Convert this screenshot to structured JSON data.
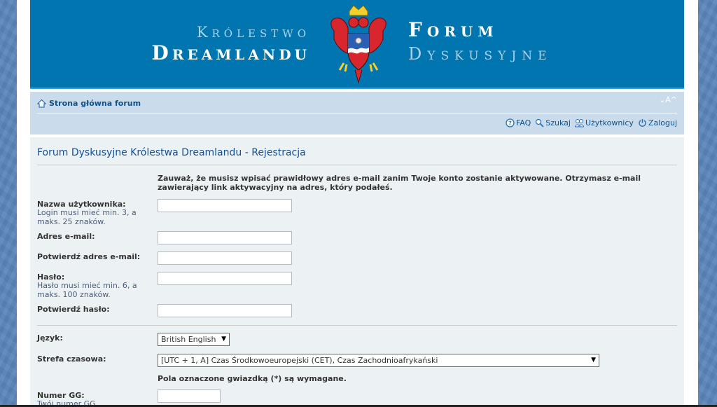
{
  "header": {
    "left_line1": "Królestwo",
    "left_line2": "Dreamlandu",
    "right_line1": "Forum",
    "right_line2": "Dyskusyjne",
    "crest_icon": "coat-of-arms-eagle-icon"
  },
  "navbar": {
    "breadcrumb_home": "Strona główna forum",
    "font_size_control": "⌄A^",
    "links": [
      {
        "label": "FAQ",
        "icon": "faq-icon"
      },
      {
        "label": "Szukaj",
        "icon": "search-icon"
      },
      {
        "label": "Użytkownicy",
        "icon": "users-icon"
      },
      {
        "label": "Zaloguj",
        "icon": "power-icon"
      }
    ]
  },
  "page": {
    "title": "Forum Dyskusyjne Królestwa Dreamlandu - Rejestracja",
    "notice": "Zauważ, że musisz wpisać prawidłowy adres e-mail zanim Twoje konto zostanie aktywowane. Otrzymasz e-mail zawierający link aktywacyjny na adres, który podałeś.",
    "fields": {
      "username": {
        "label": "Nazwa użytkownika:",
        "hint": "Login musi mieć min. 3, a maks. 25 znaków.",
        "value": ""
      },
      "email": {
        "label": "Adres e-mail:",
        "value": ""
      },
      "email_confirm": {
        "label": "Potwierdź adres e-mail:",
        "value": ""
      },
      "password": {
        "label": "Hasło:",
        "hint": "Hasło musi mieć min. 6, a maks. 100 znaków.",
        "value": ""
      },
      "password_confirm": {
        "label": "Potwierdź hasło:",
        "value": ""
      },
      "language": {
        "label": "Język:",
        "selected": "British English"
      },
      "timezone": {
        "label": "Strefa czasowa:",
        "selected": "[UTC + 1, A] Czas Środkowoeuropejski (CET), Czas Zachodnioafrykański"
      },
      "gg": {
        "label": "Numer GG:",
        "hint": "Twój numer GG",
        "value": ""
      }
    },
    "required_note": "Pola oznaczone gwiazdką (*) są wymagane."
  }
}
